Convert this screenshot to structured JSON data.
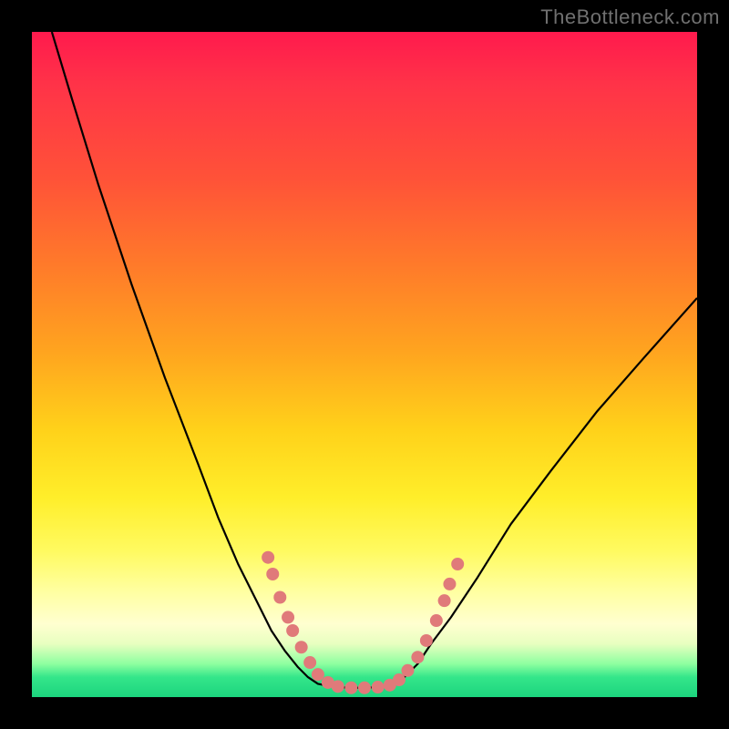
{
  "watermark": "TheBottleneck.com",
  "chart_data": {
    "type": "line",
    "title": "",
    "xlabel": "",
    "ylabel": "",
    "xlim": [
      0,
      100
    ],
    "ylim": [
      0,
      100
    ],
    "grid": false,
    "legend": false,
    "gradient_stops": [
      {
        "pct": 0,
        "color": "#ff1a4d"
      },
      {
        "pct": 22,
        "color": "#ff5238"
      },
      {
        "pct": 48,
        "color": "#ffa41f"
      },
      {
        "pct": 70,
        "color": "#ffee2a"
      },
      {
        "pct": 89,
        "color": "#ffffd0"
      },
      {
        "pct": 97,
        "color": "#34e68a"
      },
      {
        "pct": 100,
        "color": "#1cd47e"
      }
    ],
    "series": [
      {
        "name": "left-curve",
        "stroke": "#000000",
        "x": [
          3,
          6,
          10,
          15,
          20,
          25,
          28,
          31,
          34,
          36,
          38,
          40,
          41.5,
          43,
          44
        ],
        "values": [
          100,
          90,
          77,
          62,
          48,
          35,
          27,
          20,
          14,
          10,
          7,
          4.5,
          3,
          2,
          1.8
        ]
      },
      {
        "name": "valley-floor",
        "stroke": "#000000",
        "x": [
          44,
          46,
          48,
          50,
          52,
          54
        ],
        "values": [
          1.8,
          1.5,
          1.4,
          1.4,
          1.5,
          1.8
        ]
      },
      {
        "name": "right-curve",
        "stroke": "#000000",
        "x": [
          54,
          56,
          58,
          60,
          63,
          67,
          72,
          78,
          85,
          92,
          100
        ],
        "values": [
          1.8,
          3,
          5,
          8,
          12,
          18,
          26,
          34,
          43,
          51,
          60
        ]
      }
    ],
    "markers": {
      "color": "#e07a7a",
      "radius_px": 7,
      "points": [
        {
          "x": 35.5,
          "y": 21
        },
        {
          "x": 36.2,
          "y": 18.5
        },
        {
          "x": 37.3,
          "y": 15
        },
        {
          "x": 38.5,
          "y": 12
        },
        {
          "x": 39.2,
          "y": 10
        },
        {
          "x": 40.5,
          "y": 7.5
        },
        {
          "x": 41.8,
          "y": 5.2
        },
        {
          "x": 43.0,
          "y": 3.4
        },
        {
          "x": 44.5,
          "y": 2.2
        },
        {
          "x": 46.0,
          "y": 1.6
        },
        {
          "x": 48.0,
          "y": 1.4
        },
        {
          "x": 50.0,
          "y": 1.4
        },
        {
          "x": 52.0,
          "y": 1.5
        },
        {
          "x": 53.8,
          "y": 1.8
        },
        {
          "x": 55.2,
          "y": 2.6
        },
        {
          "x": 56.5,
          "y": 4.0
        },
        {
          "x": 58.0,
          "y": 6.0
        },
        {
          "x": 59.3,
          "y": 8.5
        },
        {
          "x": 60.8,
          "y": 11.5
        },
        {
          "x": 62.0,
          "y": 14.5
        },
        {
          "x": 62.8,
          "y": 17
        },
        {
          "x": 64.0,
          "y": 20
        }
      ]
    }
  }
}
